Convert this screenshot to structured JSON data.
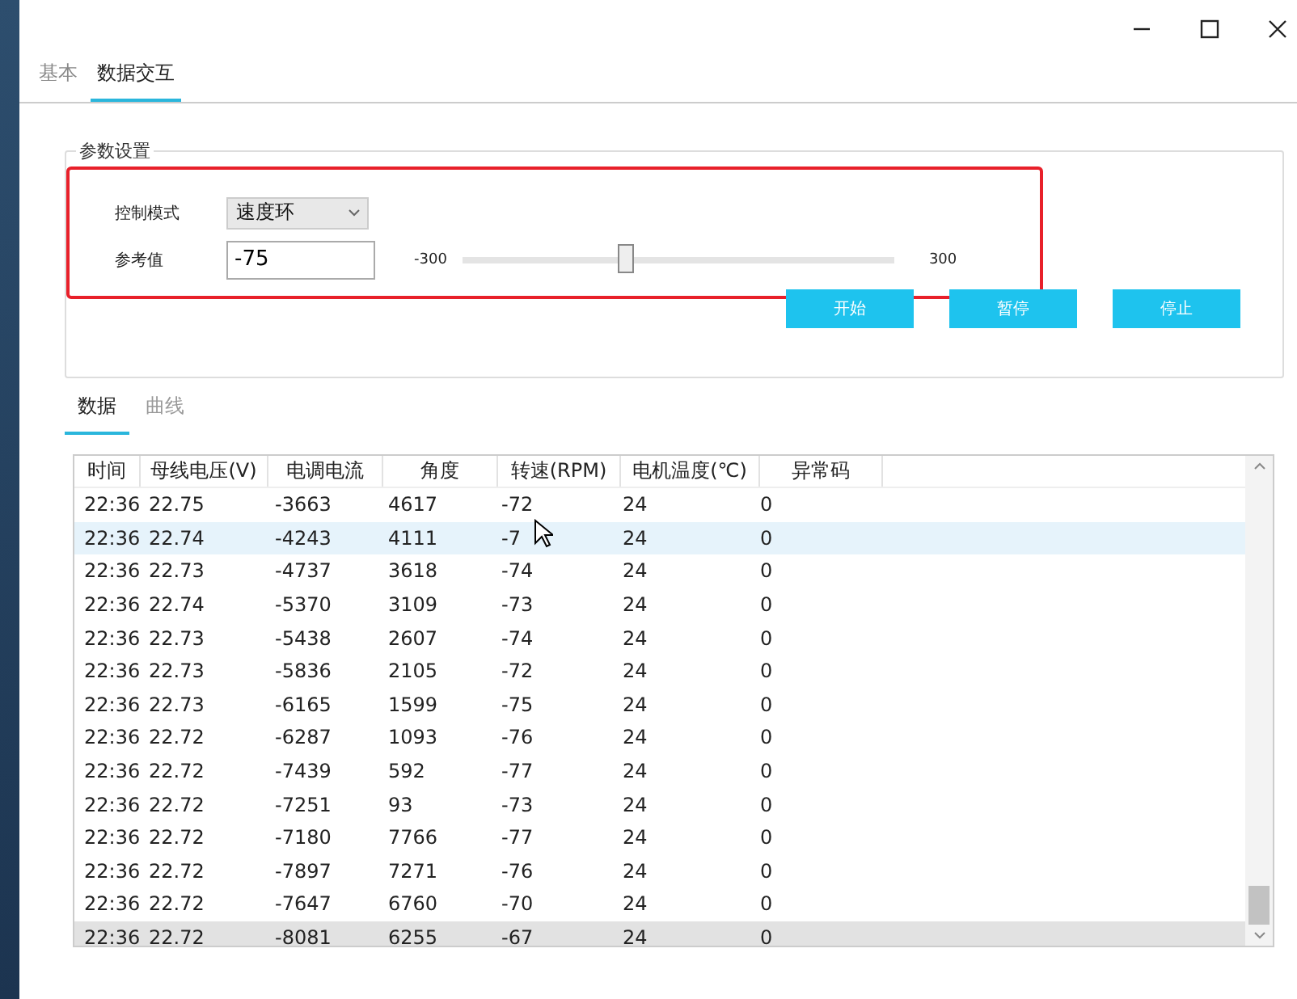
{
  "window": {
    "controls": [
      {
        "kind": "minimize"
      },
      {
        "kind": "maximize"
      },
      {
        "kind": "close"
      }
    ]
  },
  "tabs": [
    {
      "label": "基本",
      "selected": false
    },
    {
      "label": "数据交互",
      "selected": true
    }
  ],
  "params": {
    "title": "参数设置",
    "highlighted": true,
    "mode": {
      "label": "控制模式",
      "value": "速度环"
    },
    "reference": {
      "label": "参考值",
      "value": "-75",
      "min": "-300",
      "max": "300",
      "level": 0.375
    },
    "buttons": [
      "开始",
      "暂停",
      "停止"
    ]
  },
  "subtabs": [
    {
      "label": "数据",
      "selected": true
    },
    {
      "label": "曲线",
      "selected": false
    }
  ],
  "table": {
    "columns": [
      "时间",
      "母线电压(V)",
      "电调电流",
      "角度",
      "转速(RPM)",
      "电机温度(℃)",
      "异常码"
    ],
    "rows": [
      {
        "cells": [
          "22:36",
          "22.75",
          "-3663",
          "4617",
          "-72",
          "24",
          "0"
        ],
        "selected": false,
        "hovered": false
      },
      {
        "cells": [
          "22:36",
          "22.74",
          "-4243",
          "4111",
          "-7",
          "24",
          "0"
        ],
        "selected": false,
        "hovered": true
      },
      {
        "cells": [
          "22:36",
          "22.73",
          "-4737",
          "3618",
          "-74",
          "24",
          "0"
        ],
        "selected": false,
        "hovered": false
      },
      {
        "cells": [
          "22:36",
          "22.74",
          "-5370",
          "3109",
          "-73",
          "24",
          "0"
        ],
        "selected": false,
        "hovered": false
      },
      {
        "cells": [
          "22:36",
          "22.73",
          "-5438",
          "2607",
          "-74",
          "24",
          "0"
        ],
        "selected": false,
        "hovered": false
      },
      {
        "cells": [
          "22:36",
          "22.73",
          "-5836",
          "2105",
          "-72",
          "24",
          "0"
        ],
        "selected": false,
        "hovered": false
      },
      {
        "cells": [
          "22:36",
          "22.73",
          "-6165",
          "1599",
          "-75",
          "24",
          "0"
        ],
        "selected": false,
        "hovered": false
      },
      {
        "cells": [
          "22:36",
          "22.72",
          "-6287",
          "1093",
          "-76",
          "24",
          "0"
        ],
        "selected": false,
        "hovered": false
      },
      {
        "cells": [
          "22:36",
          "22.72",
          "-7439",
          "592",
          "-77",
          "24",
          "0"
        ],
        "selected": false,
        "hovered": false
      },
      {
        "cells": [
          "22:36",
          "22.72",
          "-7251",
          "93",
          "-73",
          "24",
          "0"
        ],
        "selected": false,
        "hovered": false
      },
      {
        "cells": [
          "22:36",
          "22.72",
          "-7180",
          "7766",
          "-77",
          "24",
          "0"
        ],
        "selected": false,
        "hovered": false
      },
      {
        "cells": [
          "22:36",
          "22.72",
          "-7897",
          "7271",
          "-76",
          "24",
          "0"
        ],
        "selected": false,
        "hovered": false
      },
      {
        "cells": [
          "22:36",
          "22.72",
          "-7647",
          "6760",
          "-70",
          "24",
          "0"
        ],
        "selected": false,
        "hovered": false
      },
      {
        "cells": [
          "22:36",
          "22.72",
          "-8081",
          "6255",
          "-67",
          "24",
          "0"
        ],
        "selected": true,
        "hovered": false
      }
    ]
  }
}
